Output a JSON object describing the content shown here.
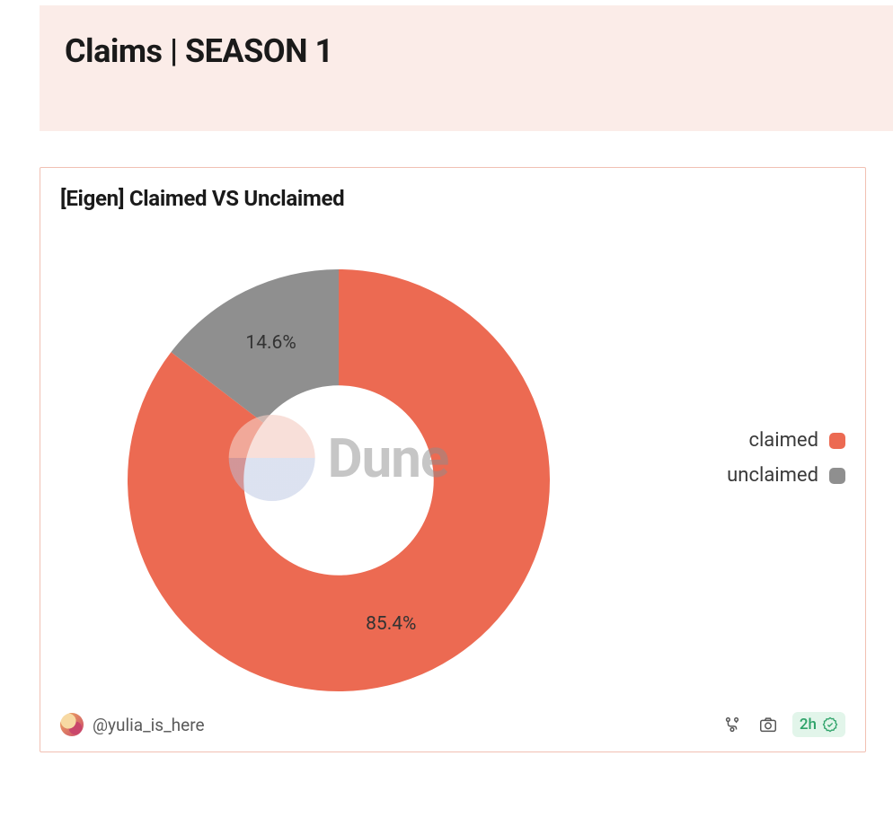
{
  "header": {
    "title": "Claims | SEASON 1"
  },
  "card": {
    "title": "[Eigen] Claimed VS Unclaimed",
    "watermark_text": "Dune",
    "author_handle": "@yulia_is_here",
    "refresh_age": "2h"
  },
  "legend": [
    {
      "name": "claimed",
      "color": "#ec6a52"
    },
    {
      "name": "unclaimed",
      "color": "#8f8f8f"
    }
  ],
  "chart_data": {
    "type": "pie",
    "title": "[Eigen] Claimed VS Unclaimed",
    "series": [
      {
        "name": "claimed",
        "value": 85.4,
        "label": "85.4%",
        "color": "#ec6a52"
      },
      {
        "name": "unclaimed",
        "value": 14.6,
        "label": "14.6%",
        "color": "#8f8f8f"
      }
    ],
    "donut_inner_radius_ratio": 0.45,
    "start_angle_deg": 0,
    "direction": "clockwise"
  }
}
